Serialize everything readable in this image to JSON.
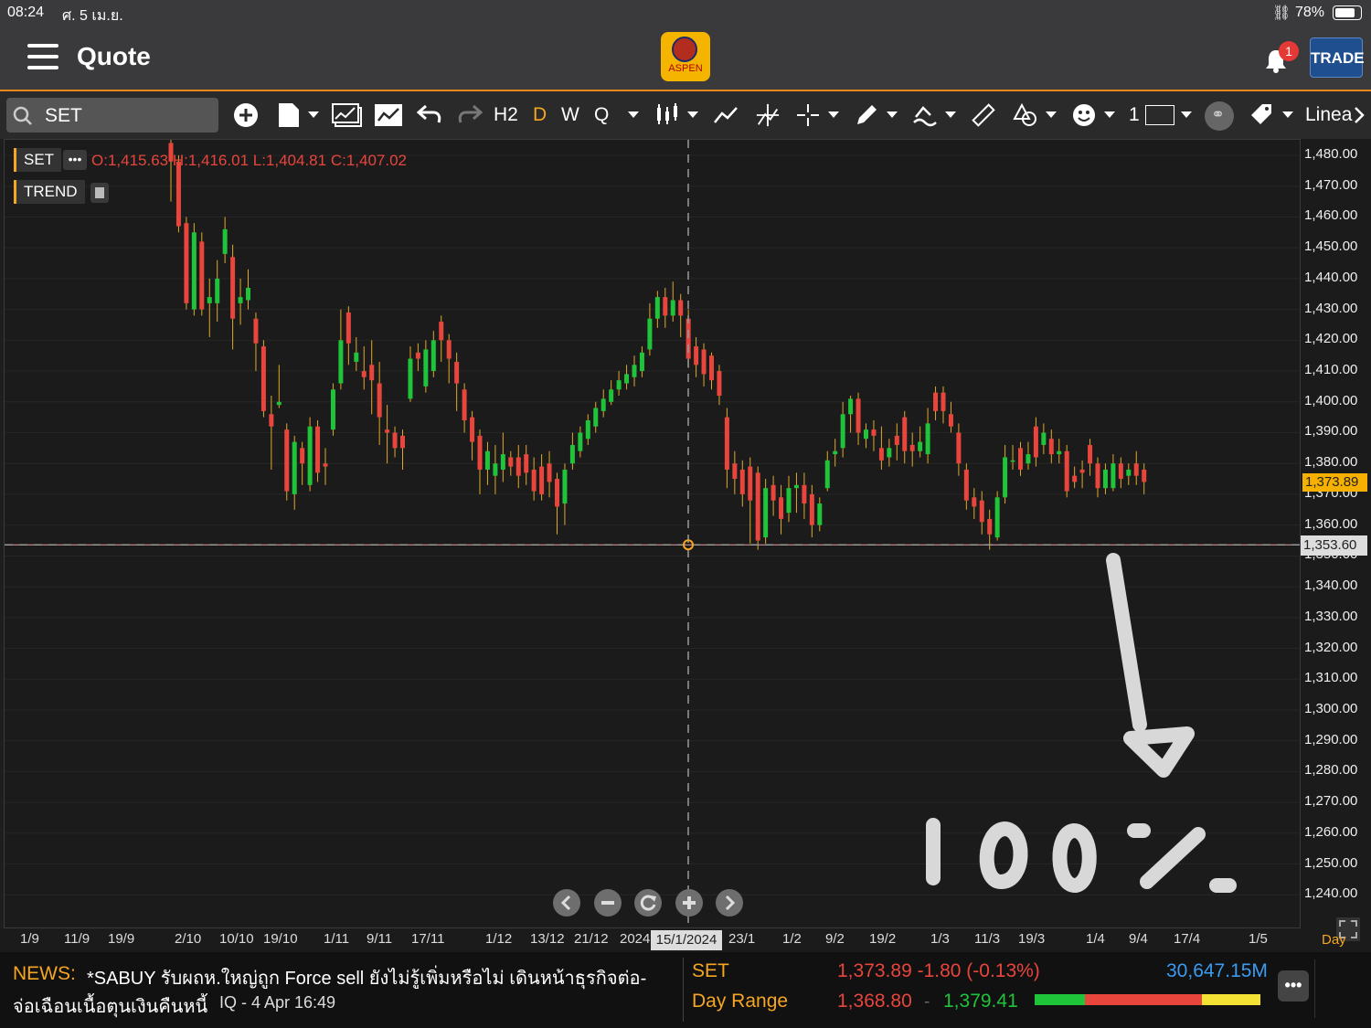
{
  "status": {
    "time": "08:24",
    "date": "ศ. 5 เม.ย.",
    "battery": "78%"
  },
  "appbar": {
    "title": "Quote",
    "logo_text": "ASPEN",
    "notification_count": "1",
    "trade_label": "TRADE"
  },
  "toolbar": {
    "symbol": "SET",
    "periods": [
      "H2",
      "D",
      "W",
      "Q"
    ],
    "active_period": "D",
    "line_width": "1",
    "scale": "Linea"
  },
  "legend": {
    "symbol_chip": "SET",
    "ohlc": "O:1,415.63 H:1,416.01 L:1,404.81 C:1,407.02",
    "indicator_chip": "TREND"
  },
  "price_axis": {
    "ticks": [
      "1,480.00",
      "1,470.00",
      "1,460.00",
      "1,450.00",
      "1,440.00",
      "1,430.00",
      "1,420.00",
      "1,410.00",
      "1,400.00",
      "1,390.00",
      "1,380.00",
      "1,370.00",
      "1,360.00",
      "1,350.00",
      "1,340.00",
      "1,330.00",
      "1,320.00",
      "1,310.00",
      "1,300.00",
      "1,290.00",
      "1,280.00",
      "1,270.00",
      "1,260.00",
      "1,250.00",
      "1,240.00"
    ],
    "last_price": "1,373.89",
    "crosshair_price": "1,353.60"
  },
  "date_axis": {
    "ticks": [
      "1/9",
      "11/9",
      "19/9",
      "2/10",
      "10/10",
      "19/10",
      "1/11",
      "9/11",
      "17/11",
      "1/12",
      "13/12",
      "21/12",
      "2024",
      "23/1",
      "1/2",
      "9/2",
      "19/2",
      "1/3",
      "11/3",
      "19/3",
      "1/4",
      "9/4",
      "17/4",
      "1/5"
    ],
    "crosshair_date": "15/1/2024",
    "interval": "Day"
  },
  "annotation": {
    "handwritten": "100%"
  },
  "news": {
    "label": "NEWS:",
    "headline_line1": "*SABUY รับผถห.ใหญ่ถูก Force sell ยังไม่รู้เพิ่มหรือไม่ เดินหน้าธุรกิจต่อ-",
    "headline_line2": "จ่อเฉือนเนื้อตุนเงินคืนหนี้",
    "source": "IQ - 4 Apr 16:49"
  },
  "quote": {
    "symbol": "SET",
    "last": "1,373.89 -1.80 (-0.13%)",
    "value": "30,647.15M",
    "range_label": "Day Range",
    "low": "1,368.80",
    "high": "1,379.41"
  },
  "colors": {
    "up": "#1fc43a",
    "down": "#e8453c",
    "accent": "#f5a623",
    "value_blue": "#3a9bf0"
  },
  "chart_data": {
    "type": "candlestick",
    "ylim": [
      1235,
      1485
    ],
    "x_range": [
      "2023-09-01",
      "2024-05-01"
    ],
    "candles": [
      {
        "o": 1484,
        "c": 1478,
        "h": 1486,
        "l": 1465
      },
      {
        "o": 1478,
        "c": 1457,
        "h": 1480,
        "l": 1455
      },
      {
        "o": 1458,
        "c": 1432,
        "h": 1460,
        "l": 1430
      },
      {
        "o": 1430,
        "c": 1455,
        "h": 1458,
        "l": 1428
      },
      {
        "o": 1452,
        "c": 1430,
        "h": 1455,
        "l": 1428
      },
      {
        "o": 1432,
        "c": 1434,
        "h": 1440,
        "l": 1421
      },
      {
        "o": 1432,
        "c": 1440,
        "h": 1446,
        "l": 1426
      },
      {
        "o": 1448,
        "c": 1456,
        "h": 1460,
        "l": 1445
      },
      {
        "o": 1447,
        "c": 1427,
        "h": 1451,
        "l": 1417
      },
      {
        "o": 1432,
        "c": 1434,
        "h": 1440,
        "l": 1425
      },
      {
        "o": 1433,
        "c": 1437,
        "h": 1443,
        "l": 1430
      },
      {
        "o": 1427,
        "c": 1419,
        "h": 1429,
        "l": 1410
      },
      {
        "o": 1418,
        "c": 1397,
        "h": 1420,
        "l": 1395
      },
      {
        "o": 1396,
        "c": 1392,
        "h": 1402,
        "l": 1378
      },
      {
        "o": 1399,
        "c": 1400,
        "h": 1412,
        "l": 1398
      },
      {
        "o": 1391,
        "c": 1371,
        "h": 1393,
        "l": 1368
      },
      {
        "o": 1370,
        "c": 1387,
        "h": 1389,
        "l": 1365
      },
      {
        "o": 1385,
        "c": 1380,
        "h": 1387,
        "l": 1373
      },
      {
        "o": 1373,
        "c": 1392,
        "h": 1395,
        "l": 1371
      },
      {
        "o": 1392,
        "c": 1377,
        "h": 1394,
        "l": 1374
      },
      {
        "o": 1380,
        "c": 1379,
        "h": 1385,
        "l": 1373
      },
      {
        "o": 1391,
        "c": 1404,
        "h": 1406,
        "l": 1389
      },
      {
        "o": 1406,
        "c": 1420,
        "h": 1430,
        "l": 1404
      },
      {
        "o": 1429,
        "c": 1419,
        "h": 1431,
        "l": 1412
      },
      {
        "o": 1413,
        "c": 1416,
        "h": 1421,
        "l": 1410
      },
      {
        "o": 1410,
        "c": 1408,
        "h": 1418,
        "l": 1404
      },
      {
        "o": 1412,
        "c": 1407,
        "h": 1420,
        "l": 1396
      },
      {
        "o": 1406,
        "c": 1395,
        "h": 1413,
        "l": 1386
      },
      {
        "o": 1391,
        "c": 1390,
        "h": 1399,
        "l": 1380
      },
      {
        "o": 1390,
        "c": 1385,
        "h": 1392,
        "l": 1382
      },
      {
        "o": 1389,
        "c": 1385,
        "h": 1391,
        "l": 1378
      },
      {
        "o": 1401,
        "c": 1414,
        "h": 1418,
        "l": 1400
      },
      {
        "o": 1416,
        "c": 1414,
        "h": 1419,
        "l": 1410
      },
      {
        "o": 1405,
        "c": 1417,
        "h": 1420,
        "l": 1403
      },
      {
        "o": 1410,
        "c": 1420,
        "h": 1423,
        "l": 1408
      },
      {
        "o": 1426,
        "c": 1420,
        "h": 1428,
        "l": 1413
      },
      {
        "o": 1420,
        "c": 1414,
        "h": 1422,
        "l": 1406
      },
      {
        "o": 1413,
        "c": 1406,
        "h": 1416,
        "l": 1397
      },
      {
        "o": 1404,
        "c": 1394,
        "h": 1406,
        "l": 1390
      },
      {
        "o": 1395,
        "c": 1387,
        "h": 1397,
        "l": 1381
      },
      {
        "o": 1389,
        "c": 1378,
        "h": 1391,
        "l": 1370
      },
      {
        "o": 1378,
        "c": 1384,
        "h": 1387,
        "l": 1373
      },
      {
        "o": 1376,
        "c": 1380,
        "h": 1386,
        "l": 1370
      },
      {
        "o": 1378,
        "c": 1383,
        "h": 1390,
        "l": 1374
      },
      {
        "o": 1382,
        "c": 1379,
        "h": 1384,
        "l": 1376
      },
      {
        "o": 1382,
        "c": 1376,
        "h": 1386,
        "l": 1372
      },
      {
        "o": 1383,
        "c": 1377,
        "h": 1386,
        "l": 1373
      },
      {
        "o": 1378,
        "c": 1371,
        "h": 1382,
        "l": 1368
      },
      {
        "o": 1379,
        "c": 1370,
        "h": 1383,
        "l": 1368
      },
      {
        "o": 1380,
        "c": 1374,
        "h": 1384,
        "l": 1369
      },
      {
        "o": 1375,
        "c": 1366,
        "h": 1377,
        "l": 1357
      },
      {
        "o": 1367,
        "c": 1378,
        "h": 1380,
        "l": 1360
      },
      {
        "o": 1380,
        "c": 1386,
        "h": 1390,
        "l": 1378
      },
      {
        "o": 1384,
        "c": 1390,
        "h": 1392,
        "l": 1382
      },
      {
        "o": 1388,
        "c": 1394,
        "h": 1396,
        "l": 1386
      },
      {
        "o": 1392,
        "c": 1398,
        "h": 1400,
        "l": 1390
      },
      {
        "o": 1397,
        "c": 1401,
        "h": 1404,
        "l": 1395
      },
      {
        "o": 1400,
        "c": 1404,
        "h": 1407,
        "l": 1399
      },
      {
        "o": 1404,
        "c": 1407,
        "h": 1410,
        "l": 1402
      },
      {
        "o": 1406,
        "c": 1409,
        "h": 1412,
        "l": 1404
      },
      {
        "o": 1408,
        "c": 1412,
        "h": 1415,
        "l": 1405
      },
      {
        "o": 1410,
        "c": 1416,
        "h": 1418,
        "l": 1408
      },
      {
        "o": 1417,
        "c": 1427,
        "h": 1432,
        "l": 1415
      },
      {
        "o": 1427,
        "c": 1434,
        "h": 1436,
        "l": 1424
      },
      {
        "o": 1434,
        "c": 1428,
        "h": 1437,
        "l": 1424
      },
      {
        "o": 1428,
        "c": 1433,
        "h": 1439,
        "l": 1426
      },
      {
        "o": 1433,
        "c": 1428,
        "h": 1435,
        "l": 1421
      },
      {
        "o": 1427,
        "c": 1414,
        "h": 1430,
        "l": 1411
      },
      {
        "o": 1418,
        "c": 1412,
        "h": 1421,
        "l": 1408
      },
      {
        "o": 1417,
        "c": 1409,
        "h": 1419,
        "l": 1405
      },
      {
        "o": 1415,
        "c": 1407,
        "h": 1416,
        "l": 1404
      },
      {
        "o": 1410,
        "c": 1402,
        "h": 1412,
        "l": 1399
      },
      {
        "o": 1395,
        "c": 1378,
        "h": 1398,
        "l": 1372
      },
      {
        "o": 1380,
        "c": 1375,
        "h": 1384,
        "l": 1370
      },
      {
        "o": 1378,
        "c": 1370,
        "h": 1381,
        "l": 1366
      },
      {
        "o": 1379,
        "c": 1368,
        "h": 1382,
        "l": 1354
      },
      {
        "o": 1377,
        "c": 1355,
        "h": 1379,
        "l": 1352
      },
      {
        "o": 1356,
        "c": 1372,
        "h": 1375,
        "l": 1354
      },
      {
        "o": 1373,
        "c": 1368,
        "h": 1376,
        "l": 1363
      },
      {
        "o": 1369,
        "c": 1362,
        "h": 1373,
        "l": 1357
      },
      {
        "o": 1364,
        "c": 1372,
        "h": 1376,
        "l": 1361
      },
      {
        "o": 1372,
        "c": 1373,
        "h": 1377,
        "l": 1364
      },
      {
        "o": 1373,
        "c": 1367,
        "h": 1377,
        "l": 1362
      },
      {
        "o": 1370,
        "c": 1360,
        "h": 1373,
        "l": 1356
      },
      {
        "o": 1360,
        "c": 1367,
        "h": 1369,
        "l": 1358
      },
      {
        "o": 1372,
        "c": 1381,
        "h": 1384,
        "l": 1371
      },
      {
        "o": 1383,
        "c": 1384,
        "h": 1388,
        "l": 1379
      },
      {
        "o": 1385,
        "c": 1396,
        "h": 1400,
        "l": 1382
      },
      {
        "o": 1396,
        "c": 1401,
        "h": 1402,
        "l": 1390
      },
      {
        "o": 1401,
        "c": 1390,
        "h": 1403,
        "l": 1386
      },
      {
        "o": 1388,
        "c": 1391,
        "h": 1393,
        "l": 1385
      },
      {
        "o": 1391,
        "c": 1389,
        "h": 1394,
        "l": 1384
      },
      {
        "o": 1385,
        "c": 1381,
        "h": 1392,
        "l": 1378
      },
      {
        "o": 1382,
        "c": 1385,
        "h": 1388,
        "l": 1379
      },
      {
        "o": 1389,
        "c": 1386,
        "h": 1393,
        "l": 1381
      },
      {
        "o": 1395,
        "c": 1384,
        "h": 1397,
        "l": 1380
      },
      {
        "o": 1386,
        "c": 1384,
        "h": 1390,
        "l": 1379
      },
      {
        "o": 1384,
        "c": 1387,
        "h": 1392,
        "l": 1382
      },
      {
        "o": 1383,
        "c": 1393,
        "h": 1398,
        "l": 1380
      },
      {
        "o": 1403,
        "c": 1397,
        "h": 1405,
        "l": 1394
      },
      {
        "o": 1403,
        "c": 1397,
        "h": 1405,
        "l": 1393
      },
      {
        "o": 1396,
        "c": 1392,
        "h": 1400,
        "l": 1390
      },
      {
        "o": 1390,
        "c": 1380,
        "h": 1393,
        "l": 1376
      },
      {
        "o": 1378,
        "c": 1368,
        "h": 1380,
        "l": 1365
      },
      {
        "o": 1369,
        "c": 1366,
        "h": 1372,
        "l": 1362
      },
      {
        "o": 1368,
        "c": 1361,
        "h": 1371,
        "l": 1357
      },
      {
        "o": 1362,
        "c": 1357,
        "h": 1365,
        "l": 1352
      },
      {
        "o": 1356,
        "c": 1369,
        "h": 1371,
        "l": 1355
      },
      {
        "o": 1369,
        "c": 1382,
        "h": 1386,
        "l": 1367
      },
      {
        "o": 1381,
        "c": 1381,
        "h": 1386,
        "l": 1378
      },
      {
        "o": 1385,
        "c": 1378,
        "h": 1387,
        "l": 1376
      },
      {
        "o": 1380,
        "c": 1383,
        "h": 1387,
        "l": 1378
      },
      {
        "o": 1392,
        "c": 1382,
        "h": 1395,
        "l": 1379
      },
      {
        "o": 1386,
        "c": 1390,
        "h": 1393,
        "l": 1383
      },
      {
        "o": 1388,
        "c": 1383,
        "h": 1391,
        "l": 1380
      },
      {
        "o": 1383,
        "c": 1384,
        "h": 1388,
        "l": 1380
      },
      {
        "o": 1384,
        "c": 1371,
        "h": 1386,
        "l": 1369
      },
      {
        "o": 1376,
        "c": 1374,
        "h": 1379,
        "l": 1372
      },
      {
        "o": 1378,
        "c": 1377,
        "h": 1381,
        "l": 1372
      },
      {
        "o": 1386,
        "c": 1380,
        "h": 1388,
        "l": 1376
      },
      {
        "o": 1380,
        "c": 1372,
        "h": 1382,
        "l": 1369
      },
      {
        "o": 1372,
        "c": 1378,
        "h": 1380,
        "l": 1370
      },
      {
        "o": 1372,
        "c": 1380,
        "h": 1383,
        "l": 1371
      },
      {
        "o": 1380,
        "c": 1375,
        "h": 1382,
        "l": 1372
      },
      {
        "o": 1376,
        "c": 1378,
        "h": 1380,
        "l": 1373
      },
      {
        "o": 1380,
        "c": 1376,
        "h": 1384,
        "l": 1373
      },
      {
        "o": 1378,
        "c": 1374,
        "h": 1380,
        "l": 1370
      }
    ]
  }
}
